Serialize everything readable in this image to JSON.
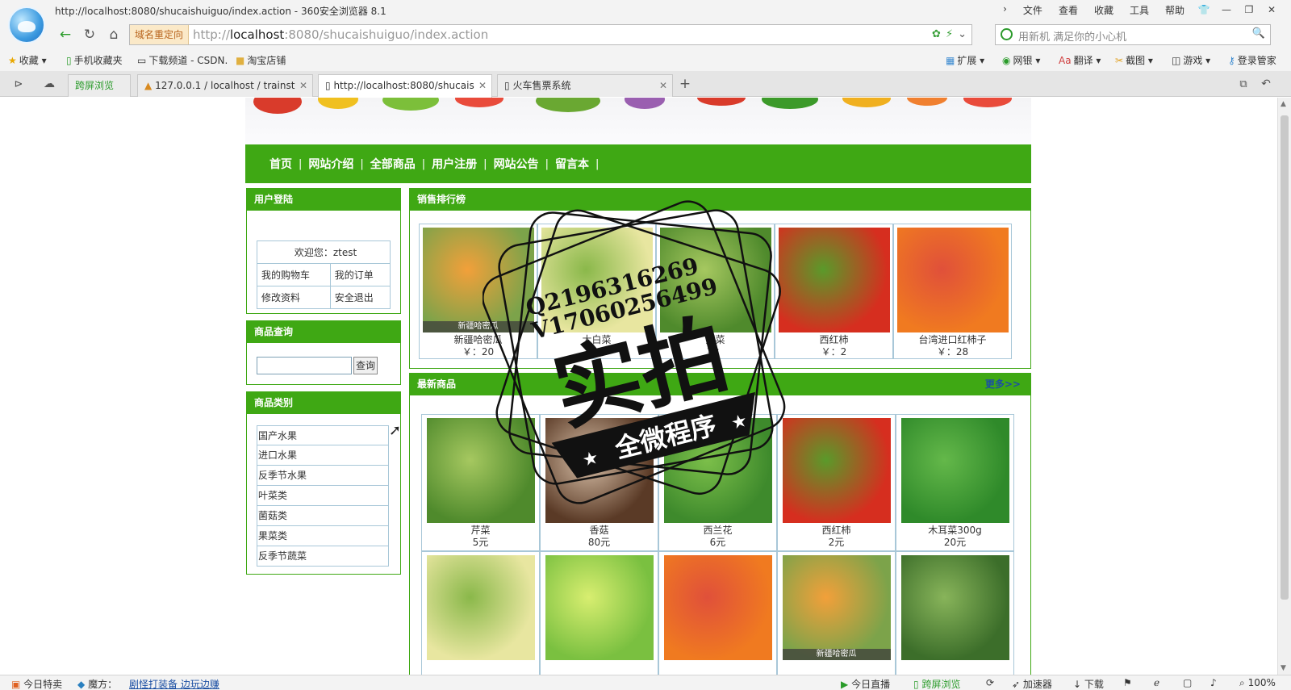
{
  "window": {
    "title": "http://localhost:8080/shucaishuiguo/index.action - 360安全浏览器 8.1",
    "menu": [
      "文件",
      "查看",
      "收藏",
      "工具",
      "帮助"
    ]
  },
  "address": {
    "redirect_label": "域名重定向",
    "url_prefix": "http://",
    "url_host": "localhost",
    "url_rest": ":8080/shucaishuiguo/index.action",
    "search_placeholder": "用新机 满足你的小心机"
  },
  "favorites": {
    "left": [
      "收藏",
      "手机收藏夹",
      "下载频道 - CSDN.",
      "淘宝店铺"
    ],
    "right": [
      "扩展",
      "网银",
      "翻译",
      "截图",
      "游戏",
      "登录管家"
    ]
  },
  "tabs": {
    "split": "跨屏浏览",
    "items": [
      "127.0.0.1 / localhost / trainst",
      "http://localhost:8080/shucais",
      "火车售票系统"
    ]
  },
  "site": {
    "nav": [
      "首页",
      "网站介绍",
      "全部商品",
      "用户注册",
      "网站公告",
      "留言本"
    ],
    "login_panel": {
      "title": "用户登陆",
      "welcome": "欢迎您：ztest",
      "cart": "我的购物车",
      "orders": "我的订单",
      "edit": "修改资料",
      "logout": "安全退出"
    },
    "search_panel": {
      "title": "商品查询",
      "button": "查询"
    },
    "category_panel": {
      "title": "商品类别",
      "items": [
        "国产水果",
        "进口水果",
        "反季节水果",
        "叶菜类",
        "菌菇类",
        "果菜类",
        "反季节蔬菜"
      ]
    },
    "ranking": {
      "title": "销售排行榜",
      "items": [
        {
          "name": "新疆哈密瓜",
          "price": "￥：20",
          "tag": "新疆哈密瓜"
        },
        {
          "name": "大白菜",
          "price": "￥：9"
        },
        {
          "name": "芹菜",
          "price": "￥："
        },
        {
          "name": "西红柿",
          "price": "￥：2"
        },
        {
          "name": "台湾进口红柿子",
          "price": "￥：28"
        }
      ]
    },
    "newest": {
      "title": "最新商品",
      "more": "更多>>",
      "items": [
        {
          "name": "芹菜",
          "price": "5元"
        },
        {
          "name": "香菇",
          "price": "80元"
        },
        {
          "name": "西兰花",
          "price": "6元"
        },
        {
          "name": "西红柿",
          "price": "2元"
        },
        {
          "name": "木耳菜300g",
          "price": "20元"
        },
        {
          "name": "",
          "price": ""
        },
        {
          "name": "",
          "price": ""
        },
        {
          "name": "",
          "price": ""
        },
        {
          "name": "",
          "price": "",
          "tag": "新疆哈密瓜"
        },
        {
          "name": "",
          "price": ""
        }
      ]
    }
  },
  "watermark": {
    "line1": "Q2196316269",
    "line2": "V17060256499",
    "big": "实拍",
    "ribbon": "全微程序"
  },
  "statusbar": {
    "left": [
      "今日特卖",
      "魔方：",
      "剧怪打装备 边玩边赚"
    ],
    "right": [
      "今日直播",
      "跨屏浏览",
      "加速器",
      "下载",
      "100%"
    ]
  }
}
